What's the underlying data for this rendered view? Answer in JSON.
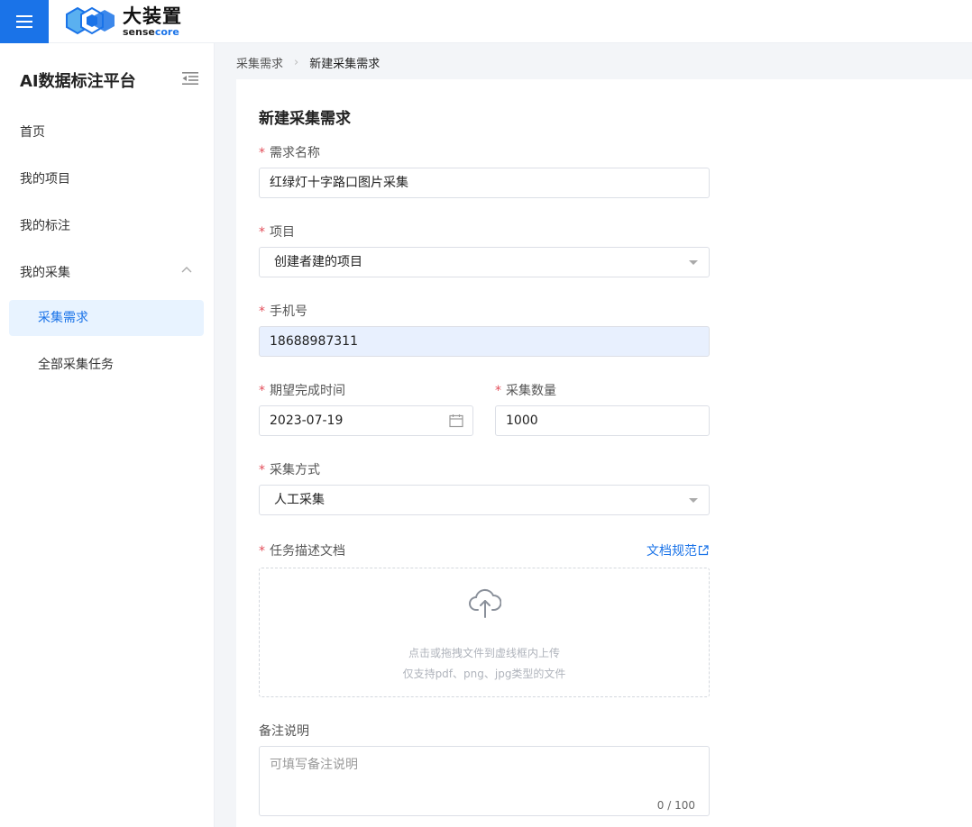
{
  "header": {
    "logo_cn": "大装置",
    "logo_en_a": "sense",
    "logo_en_b": "core"
  },
  "sidebar": {
    "platform_title": "AI数据标注平台",
    "items": [
      {
        "label": "首页"
      },
      {
        "label": "我的项目"
      },
      {
        "label": "我的标注"
      },
      {
        "label": "我的采集"
      }
    ],
    "sub_items": [
      {
        "label": "采集需求",
        "active": true
      },
      {
        "label": "全部采集任务",
        "active": false
      }
    ]
  },
  "breadcrumb": {
    "parent": "采集需求",
    "separator": "›",
    "current": "新建采集需求"
  },
  "form": {
    "title": "新建采集需求",
    "name": {
      "label": "需求名称",
      "value": "红绿灯十字路口图片采集"
    },
    "project": {
      "label": "项目",
      "value": "创建者建的项目"
    },
    "phone": {
      "label": "手机号",
      "value": "18688987311"
    },
    "due_date": {
      "label": "期望完成时间",
      "value": "2023-07-19"
    },
    "quantity": {
      "label": "采集数量",
      "value": "1000"
    },
    "method": {
      "label": "采集方式",
      "value": "人工采集"
    },
    "doc": {
      "label": "任务描述文档",
      "link": "文档规范",
      "hint1": "点击或拖拽文件到虚线框内上传",
      "hint2": "仅支持pdf、png、jpg类型的文件"
    },
    "remark": {
      "label": "备注说明",
      "placeholder": "可填写备注说明",
      "counter": "0 / 100"
    },
    "required_mark": "*"
  },
  "colors": {
    "accent": "#1a73e8",
    "required": "#e34d59",
    "active_bg": "#e8f3ff",
    "autofill_bg": "#e8f0fe"
  }
}
